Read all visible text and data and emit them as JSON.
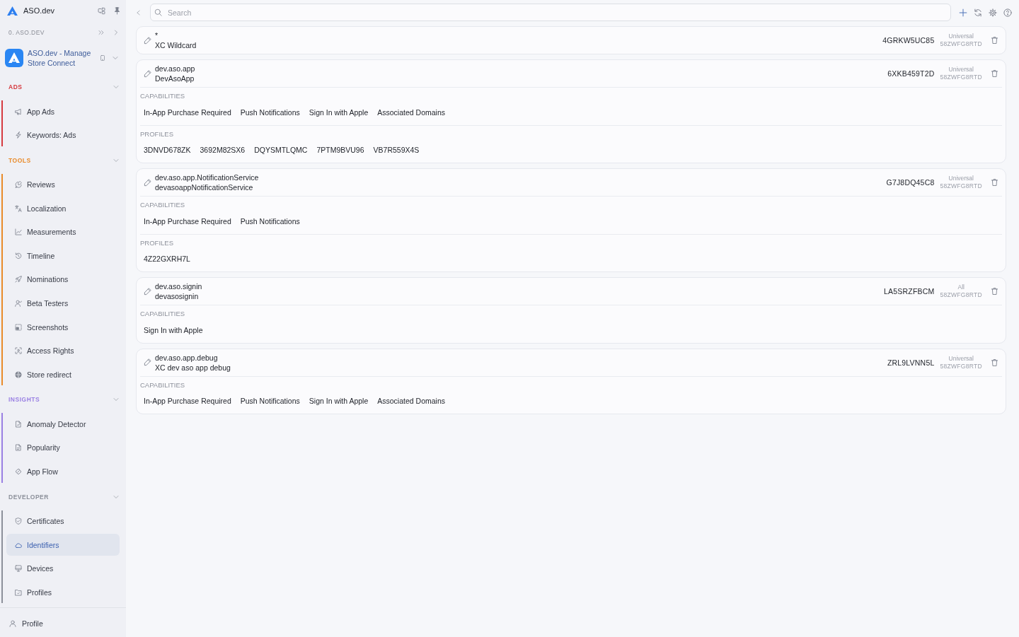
{
  "sidebar": {
    "brand": "ASO.dev",
    "account": "0. ASO.DEV",
    "app_name": "ASO.dev - Manage Store Connect",
    "sections": [
      {
        "title": "ADS",
        "color": "#d63a3f",
        "expanded": true,
        "items": [
          {
            "label": "App Ads",
            "selected": false
          },
          {
            "label": "Keywords: Ads",
            "selected": false
          }
        ]
      },
      {
        "title": "TOOLS",
        "color": "#e98b2a",
        "expanded": true,
        "items": [
          {
            "label": "Reviews",
            "selected": false
          },
          {
            "label": "Localization",
            "selected": false
          },
          {
            "label": "Measurements",
            "selected": false
          },
          {
            "label": "Timeline",
            "selected": false
          },
          {
            "label": "Nominations",
            "selected": false
          },
          {
            "label": "Beta Testers",
            "selected": false
          },
          {
            "label": "Screenshots",
            "selected": false
          },
          {
            "label": "Access Rights",
            "selected": false
          },
          {
            "label": "Store redirect",
            "selected": false
          }
        ]
      },
      {
        "title": "INSIGHTS",
        "color": "#9a80e3",
        "expanded": true,
        "items": [
          {
            "label": "Anomaly Detector",
            "selected": false
          },
          {
            "label": "Popularity",
            "selected": false
          },
          {
            "label": "App Flow",
            "selected": false
          }
        ]
      },
      {
        "title": "DEVELOPER",
        "color": "#8c909a",
        "expanded": true,
        "items": [
          {
            "label": "Certificates",
            "selected": false
          },
          {
            "label": "Identifiers",
            "selected": true
          },
          {
            "label": "Devices",
            "selected": false
          },
          {
            "label": "Profiles",
            "selected": false
          }
        ]
      }
    ],
    "profile": "Profile"
  },
  "search": {
    "placeholder": "Search"
  },
  "identifiers": [
    {
      "bundle_id": "*",
      "name": "XC Wildcard",
      "code": "4GRKW5UC85",
      "platform": "Universal",
      "team_code": "58ZWFG8RTD"
    },
    {
      "bundle_id": "dev.aso.app",
      "name": "DevAsoApp",
      "code": "6XKB459T2D",
      "platform": "Universal",
      "team_code": "58ZWFG8RTD",
      "capabilities": {
        "heading": "CAPABILITIES",
        "items": [
          "In-App Purchase Required",
          "Push Notifications",
          "Sign In with Apple",
          "Associated Domains"
        ]
      },
      "profiles": {
        "heading": "PROFILES",
        "items": [
          "3DNVD678ZK",
          "3692M82SX6",
          "DQYSMTLQMC",
          "7PTM9BVU96",
          "VB7R559X4S"
        ]
      }
    },
    {
      "bundle_id": "dev.aso.app.NotificationService",
      "name": "devasoappNotificationService",
      "code": "G7J8DQ45C8",
      "platform": "Universal",
      "team_code": "58ZWFG8RTD",
      "capabilities": {
        "heading": "CAPABILITIES",
        "items": [
          "In-App Purchase Required",
          "Push Notifications"
        ]
      },
      "profiles": {
        "heading": "PROFILES",
        "items": [
          "4Z22GXRH7L"
        ]
      }
    },
    {
      "bundle_id": "dev.aso.signin",
      "name": "devasosignin",
      "code": "LA5SRZFBCM",
      "platform": "All",
      "team_code": "58ZWFG8RTD",
      "capabilities": {
        "heading": "CAPABILITIES",
        "items": [
          "Sign In with Apple"
        ]
      }
    },
    {
      "bundle_id": "dev.aso.app.debug",
      "name": "XC dev aso app debug",
      "code": "ZRL9LVNN5L",
      "platform": "Universal",
      "team_code": "58ZWFG8RTD",
      "capabilities": {
        "heading": "CAPABILITIES",
        "items": [
          "In-App Purchase Required",
          "Push Notifications",
          "Sign In with Apple",
          "Associated Domains"
        ]
      }
    }
  ]
}
